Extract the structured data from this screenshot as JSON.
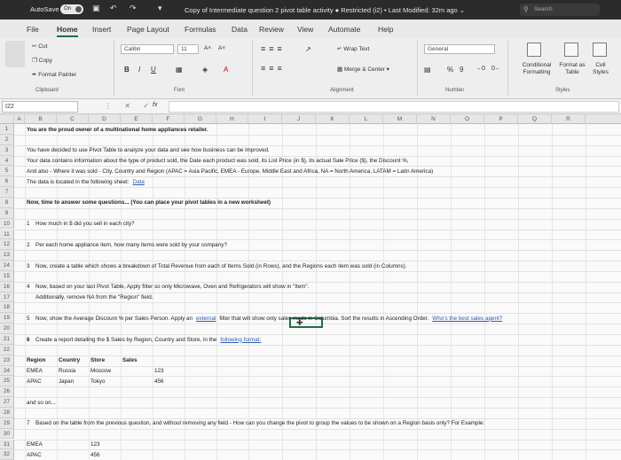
{
  "titlebar": {
    "autosave_label": "AutoSave",
    "autosave_state": "On",
    "doc_title": "Copy of Intermediate question 2 pivot table activity  ●  Restricted (i2)  •  Last Modified: 32m ago  ⌄",
    "search_placeholder": "Search"
  },
  "menu": {
    "tabs": [
      "File",
      "Home",
      "Insert",
      "Page Layout",
      "Formulas",
      "Data",
      "Review",
      "View",
      "Automate",
      "Help"
    ],
    "active": "Home"
  },
  "ribbon": {
    "cut": "Cut",
    "copy": "Copy",
    "format_painter": "Format Painter",
    "clipboard_label": "Clipboard",
    "font_name": "Calibri",
    "font_size": "11",
    "grow_font": "A˄",
    "shrink_font": "A˅",
    "bold": "B",
    "italic": "I",
    "underline": "U",
    "font_label": "Font",
    "wrap_text": "Wrap Text",
    "merge_center": "Merge & Center",
    "alignment_label": "Alignment",
    "number_format": "General",
    "percent": "%",
    "comma": "9",
    "number_label": "Number",
    "conditional_formatting": "Conditional Formatting",
    "format_as_table": "Format as Table",
    "cell_styles": "Cell Styles",
    "styles_label": "Styles"
  },
  "formula_bar": {
    "name_box": "I22",
    "fx": "fx"
  },
  "columns": [
    "A",
    "B",
    "C",
    "D",
    "E",
    "F",
    "G",
    "H",
    "I",
    "J",
    "K",
    "L",
    "M",
    "N",
    "O",
    "P",
    "Q",
    "R"
  ],
  "rows": [
    "1",
    "2",
    "3",
    "4",
    "5",
    "6",
    "7",
    "8",
    "9",
    "10",
    "11",
    "12",
    "13",
    "14",
    "15",
    "16",
    "17",
    "18",
    "19",
    "20",
    "21",
    "22",
    "23",
    "24",
    "25",
    "26",
    "27",
    "28",
    "29",
    "30",
    "31",
    "32"
  ],
  "sheet": {
    "r1": "You are the proud owner of a multinational home appliances retailer.",
    "r3": "You have decided to use Pivot Table to analyze your data and see how business can be improved.",
    "r4": "Your data contains information about the type of product sold, the Date each product was sold, its List Price (in $), its actual Sale Price ($), the Discount %,",
    "r5": "And also - Where it was sold - City, Country and Region (APAC = Asia Pacific, EMEA - Europe, Middle East and Africa, NA = North America, LATAM = Latin America)",
    "r6_text": "The data is located in the following sheet:",
    "r6_link": "Data",
    "r8": "Now, time to answer some questions... (You can place your pivot tables in a new worksheet)",
    "q1_num": "1",
    "q1": "How much in $ did you sell in each city?",
    "q2_num": "2",
    "q2": "Per each home appliance item, how many items were sold by your company?",
    "q3_num": "3",
    "q3": "Now, create a table which shows a breakdown of Total Revenue from each of Items Sold (in Rows), and the Regions each item was sold (in Columns).",
    "q4_num": "4",
    "q4": "Now, based on your last Pivot Table, Apply filter so only Microwave, Oven and Refrigerators will show in \"Item\".",
    "q4b": "Additionally, remove NA from the \"Region\" field.",
    "q5_num": "5",
    "q5": "Now, show the Average Discount % per Sales Person. Apply an",
    "q5_link": "external",
    "q5b": "filter that will show only sales made in Columbia. Sort the results in Ascending Order.",
    "q5c": "Who's the best sales agent?",
    "q6_num": "6",
    "q6": "Create a report detailing the $ Sales by Region, Country and Store, in the",
    "q6_link": "following format:",
    "table_headers": [
      "Region",
      "Country",
      "Store",
      "Sales"
    ],
    "table_rows": [
      [
        "EMEA",
        "Russia",
        "Moscow",
        "123"
      ],
      [
        "APAC",
        "Japan",
        "Tokyo",
        "456"
      ]
    ],
    "and_so_on": "and so on...",
    "q7_num": "7",
    "q7": "Based on the table from the previous question, and without removing any field - How can you change the pivot to group the values to be shown on a Region basis only? For Example:",
    "summary_rows": [
      [
        "EMEA",
        "123"
      ],
      [
        "APAC",
        "456"
      ]
    ]
  }
}
